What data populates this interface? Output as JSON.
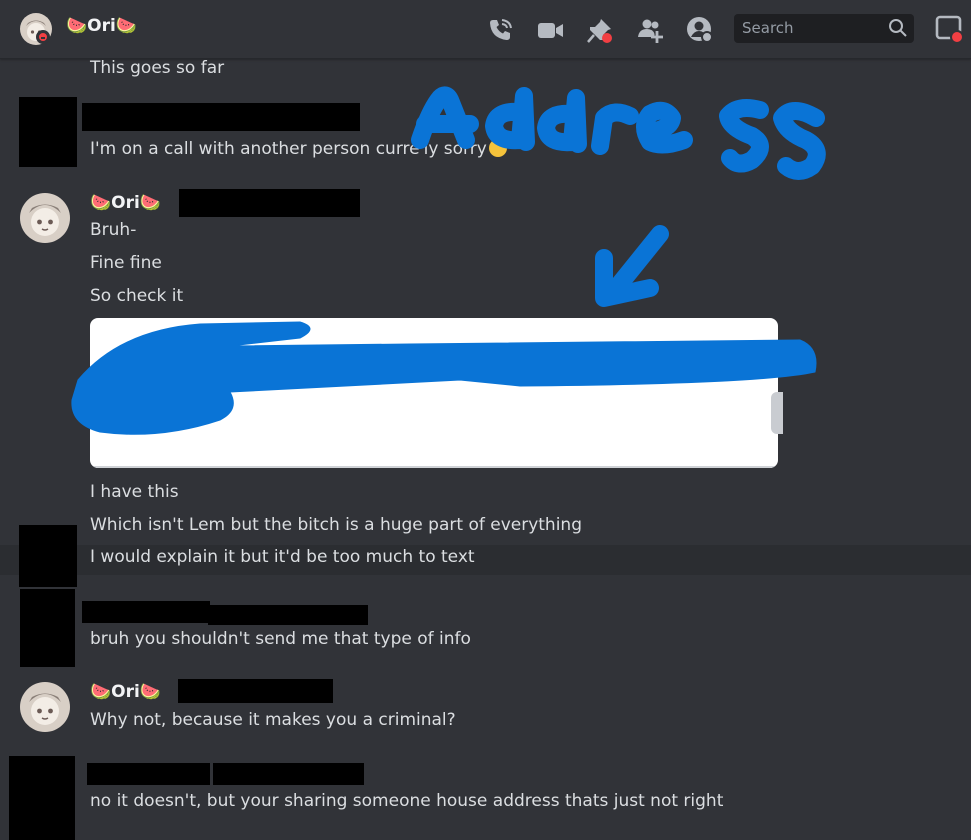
{
  "header": {
    "title": "🍉Ori🍉",
    "search_placeholder": "Search",
    "icons": [
      "phone-call-icon",
      "video-call-icon",
      "pin-icon",
      "add-friend-icon",
      "user-profile-icon",
      "inbox-icon"
    ]
  },
  "messages": [
    {
      "username": "",
      "lines": [
        "This goes so far"
      ]
    },
    {
      "username": "",
      "lines": [
        "I'm on a call with another person curre",
        "ly sorry"
      ]
    },
    {
      "username": "🍉Ori🍉",
      "lines": [
        "Bruh-",
        "Fine fine",
        "So check it",
        "I have this",
        "Which isn't Lem but the bitch is a huge part of everything",
        "I would explain it but it'd be too much to text"
      ]
    },
    {
      "username": "",
      "lines": [
        "bruh you shouldn't send me that type of info"
      ]
    },
    {
      "username": "🍉Ori🍉",
      "lines": [
        "Why not, because it makes you a criminal?"
      ]
    },
    {
      "username": "",
      "lines": [
        "no it doesn't, but your sharing someone house address thats just not right"
      ]
    }
  ],
  "colors": {
    "background": "#313338",
    "annotation_blue": "#0a74d6",
    "danger_red": "#f23f43"
  }
}
